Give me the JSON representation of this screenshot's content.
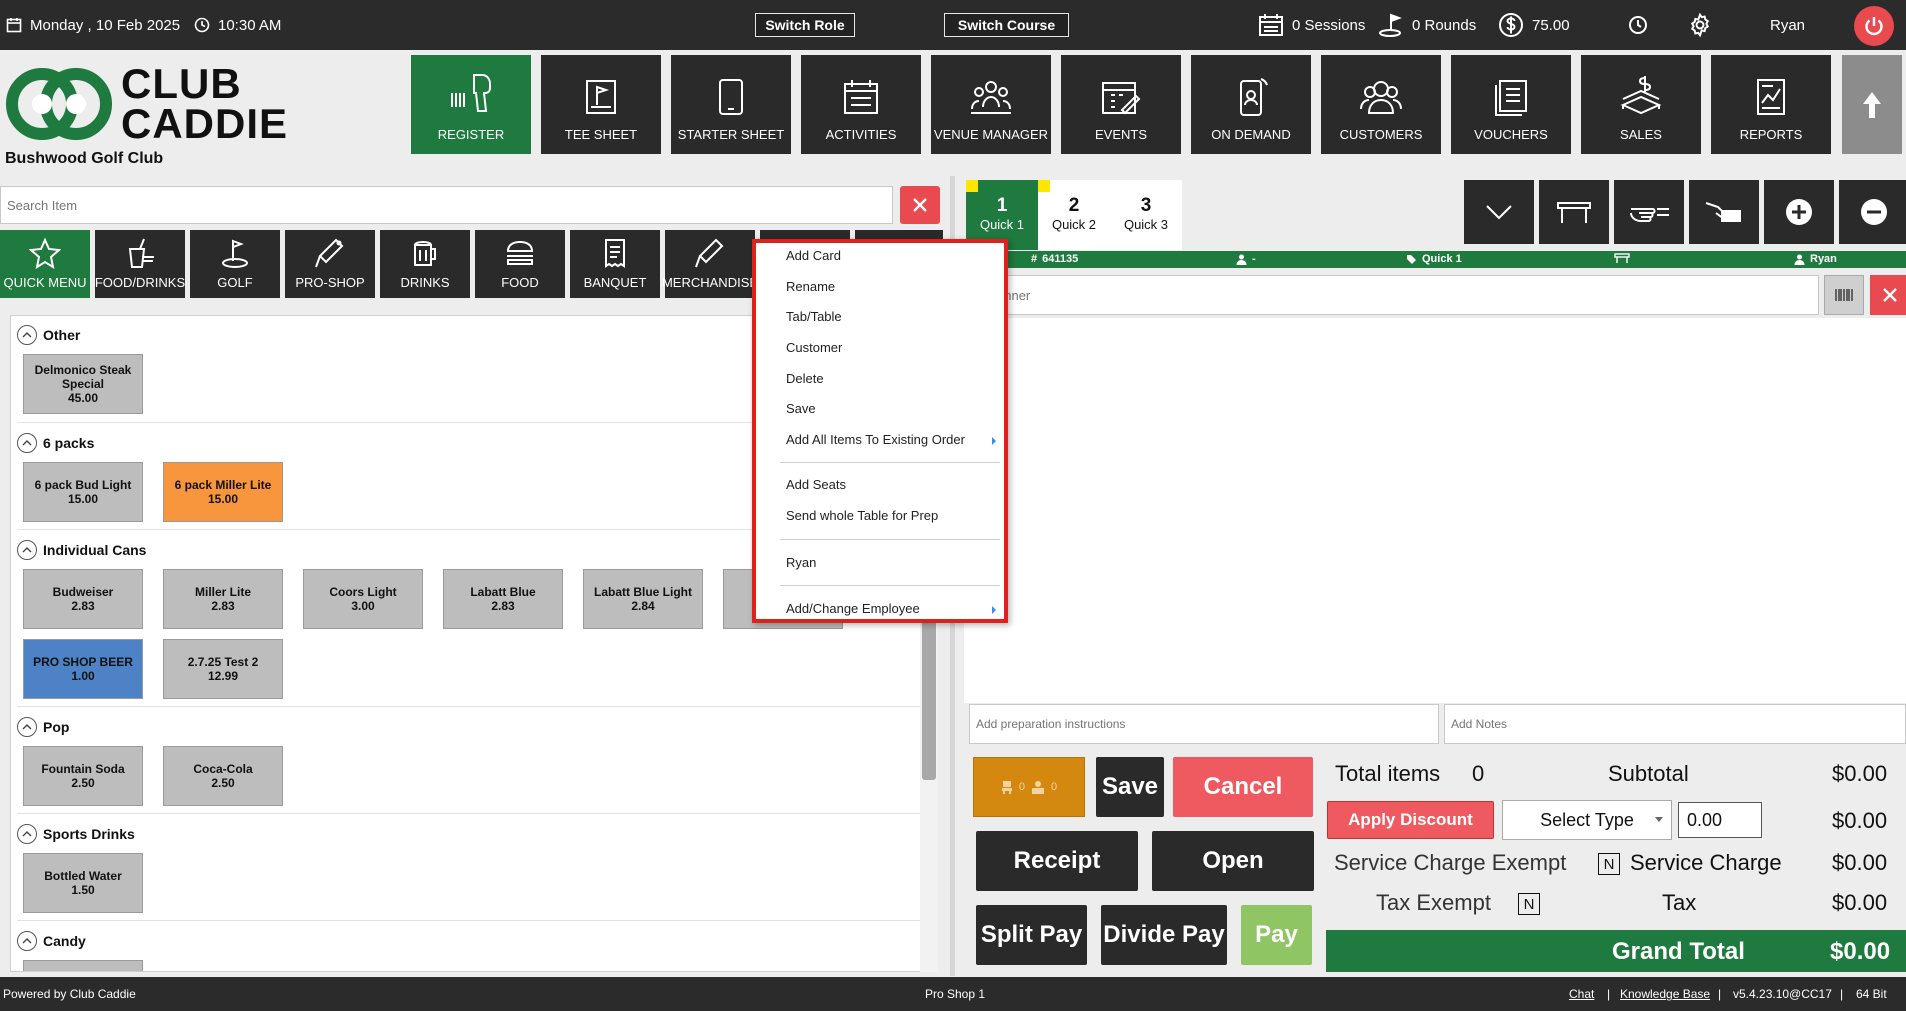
{
  "topbar": {
    "date": "Monday ,  10 Feb 2025",
    "time": "10:30 AM",
    "switch_role": "Switch Role",
    "switch_course": "Switch Course",
    "sessions": "0 Sessions",
    "rounds": "0 Rounds",
    "balance": "75.00",
    "user": "Ryan"
  },
  "header": {
    "logo_line1": "CLUB",
    "logo_line2": "CADDIE",
    "club_name": "Bushwood Golf Club"
  },
  "nav": [
    {
      "label": "REGISTER",
      "icon": "barcode-scanner-icon"
    },
    {
      "label": "TEE SHEET",
      "icon": "tee-sheet-icon"
    },
    {
      "label": "STARTER SHEET",
      "icon": "tablet-icon"
    },
    {
      "label": "ACTIVITIES",
      "icon": "calendar-icon"
    },
    {
      "label": "VENUE MANAGER",
      "icon": "venue-icon"
    },
    {
      "label": "EVENTS",
      "icon": "events-icon"
    },
    {
      "label": "ON DEMAND",
      "icon": "phone-icon"
    },
    {
      "label": "CUSTOMERS",
      "icon": "customers-icon"
    },
    {
      "label": "VOUCHERS",
      "icon": "vouchers-icon"
    },
    {
      "label": "SALES",
      "icon": "sales-icon"
    },
    {
      "label": "REPORTS",
      "icon": "reports-icon"
    }
  ],
  "search": {
    "placeholder": "Search Item"
  },
  "categories": [
    {
      "label": "QUICK MENU",
      "icon": "star-icon"
    },
    {
      "label": "FOOD/DRINKS",
      "icon": "food-drinks-icon"
    },
    {
      "label": "GOLF",
      "icon": "golf-icon"
    },
    {
      "label": "PRO-SHOP",
      "icon": "pro-shop-icon"
    },
    {
      "label": "DRINKS",
      "icon": "beer-icon"
    },
    {
      "label": "FOOD",
      "icon": "burger-icon"
    },
    {
      "label": "BANQUET",
      "icon": "receipt-icon"
    },
    {
      "label": "MERCHANDISE",
      "icon": "merchandise-icon"
    }
  ],
  "sections": [
    {
      "title": "Other",
      "items": [
        {
          "name": "Delmonico Steak Special",
          "price": "45.00"
        }
      ]
    },
    {
      "title": "6 packs",
      "items": [
        {
          "name": "6 pack Bud Light",
          "price": "15.00"
        },
        {
          "name": "6 pack Miller Lite",
          "price": "15.00"
        }
      ]
    },
    {
      "title": "Individual Cans",
      "items": [
        {
          "name": "Budweiser",
          "price": "2.83"
        },
        {
          "name": "Miller Lite",
          "price": "2.83"
        },
        {
          "name": "Coors Light",
          "price": "3.00"
        },
        {
          "name": "Labatt Blue",
          "price": "2.83"
        },
        {
          "name": "Labatt Blue Light",
          "price": "2.84"
        },
        {
          "name": "PRO SHOP BEER",
          "price": "1.00"
        },
        {
          "name": "2.7.25 Test 2",
          "price": "12.99"
        }
      ]
    },
    {
      "title": "Pop",
      "items": [
        {
          "name": "Fountain Soda",
          "price": "2.50"
        },
        {
          "name": "Coca-Cola",
          "price": "2.50"
        }
      ]
    },
    {
      "title": "Sports Drinks",
      "items": [
        {
          "name": "Bottled Water",
          "price": "1.50"
        }
      ]
    },
    {
      "title": "Candy",
      "items": []
    }
  ],
  "context_menu": {
    "items": [
      "Add Card",
      "Rename",
      "Tab/Table",
      "Customer",
      "Delete",
      "Save",
      "Add All Items To Existing Order",
      "Add Seats",
      "Send whole Table for Prep",
      "Ryan",
      "Add/Change Employee"
    ]
  },
  "quick_tabs": [
    {
      "num": "1",
      "label": "Quick 1"
    },
    {
      "num": "2",
      "label": "Quick 2"
    },
    {
      "num": "3",
      "label": "Quick 3"
    }
  ],
  "order_bar": {
    "order_no": "641135",
    "customer": "-",
    "tab": "Quick 1",
    "employee": "Ryan"
  },
  "scanner": {
    "placeholder": "e Scanner"
  },
  "notes": {
    "prep_placeholder": "Add preparation instructions",
    "notes_placeholder": "Add Notes"
  },
  "seat_counts": [
    "0",
    "0"
  ],
  "actions": {
    "save": "Save",
    "cancel": "Cancel",
    "receipt": "Receipt",
    "open": "Open",
    "split_pay": "Split Pay",
    "divide_pay": "Divide Pay",
    "pay": "Pay"
  },
  "totals": {
    "total_items_label": "Total items",
    "total_items": "0",
    "subtotal_label": "Subtotal",
    "subtotal": "$0.00",
    "apply_discount": "Apply Discount",
    "select_type": "Select Type",
    "discount_value": "0.00",
    "discount_amount": "$0.00",
    "service_exempt_label": "Service Charge Exempt",
    "service_exempt": "N",
    "service_charge_label": "Service Charge",
    "service_charge": "$0.00",
    "tax_exempt_label": "Tax Exempt",
    "tax_exempt": "N",
    "tax_label": "Tax",
    "tax": "$0.00",
    "grand_total_label": "Grand Total",
    "grand_total": "$0.00"
  },
  "footer": {
    "powered": "Powered by Club Caddie",
    "station": "Pro Shop 1",
    "chat": "Chat",
    "kb": "Knowledge Base",
    "version": "v5.4.23.10@CC17",
    "bits": "64 Bit"
  },
  "colors": {
    "brand_green": "#1f7a3f",
    "dark": "#2a2a2a",
    "red": "#e84a4f",
    "orange": "#f7963d",
    "blue": "#4e82c6",
    "highlight": "#e0201c"
  }
}
